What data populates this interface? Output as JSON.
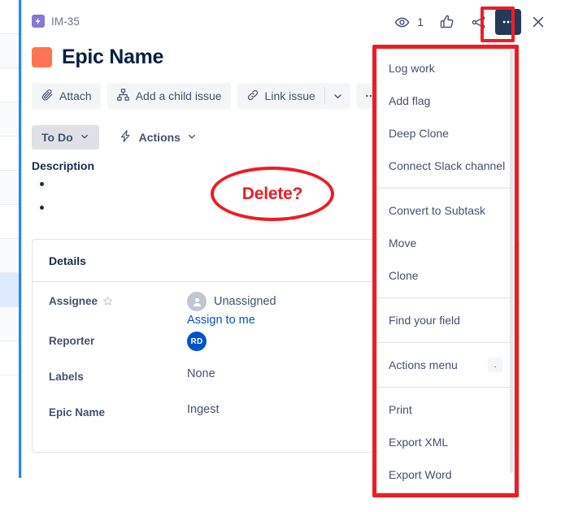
{
  "breadcrumb": {
    "issue_key": "IM-35",
    "icon": "epic-bolt-icon"
  },
  "header": {
    "watch_icon": "eye-icon",
    "watch_count": "1",
    "vote_icon": "thumbs-up-icon",
    "share_icon": "share-icon",
    "more_icon": "more-horizontal-icon",
    "close_icon": "close-x-icon"
  },
  "title": {
    "text": "Epic Name",
    "swatch_color": "#FF7452"
  },
  "toolbar": {
    "attach_label": "Attach",
    "add_child_label": "Add a child issue",
    "link_issue_label": "Link issue",
    "more_label": "..."
  },
  "status": {
    "status_label": "To Do",
    "actions_label": "Actions"
  },
  "description": {
    "label": "Description",
    "bullets": [
      "",
      ""
    ]
  },
  "details": {
    "heading": "Details",
    "rows": [
      {
        "key": "Assignee",
        "value": "Unassigned",
        "link": "Assign to me",
        "avatar": "person-placeholder-icon"
      },
      {
        "key": "Reporter",
        "value": "",
        "avatar_initials": "RD"
      },
      {
        "key": "Labels",
        "value": "None"
      },
      {
        "key": "Epic Name",
        "value": "Ingest"
      }
    ]
  },
  "menu": {
    "groups": [
      {
        "items": [
          {
            "label": "Log work"
          },
          {
            "label": "Add flag"
          },
          {
            "label": "Deep Clone"
          },
          {
            "label": "Connect Slack channel"
          }
        ]
      },
      {
        "items": [
          {
            "label": "Convert to Subtask"
          },
          {
            "label": "Move"
          },
          {
            "label": "Clone"
          }
        ]
      },
      {
        "items": [
          {
            "label": "Find your field"
          }
        ]
      },
      {
        "items": [
          {
            "label": "Actions menu",
            "shortcut": "."
          }
        ]
      },
      {
        "items": [
          {
            "label": "Print"
          },
          {
            "label": "Export XML"
          },
          {
            "label": "Export Word"
          }
        ]
      }
    ]
  },
  "annotations": {
    "delete_text": "Delete?",
    "highlight_color": "#EE1C25"
  }
}
